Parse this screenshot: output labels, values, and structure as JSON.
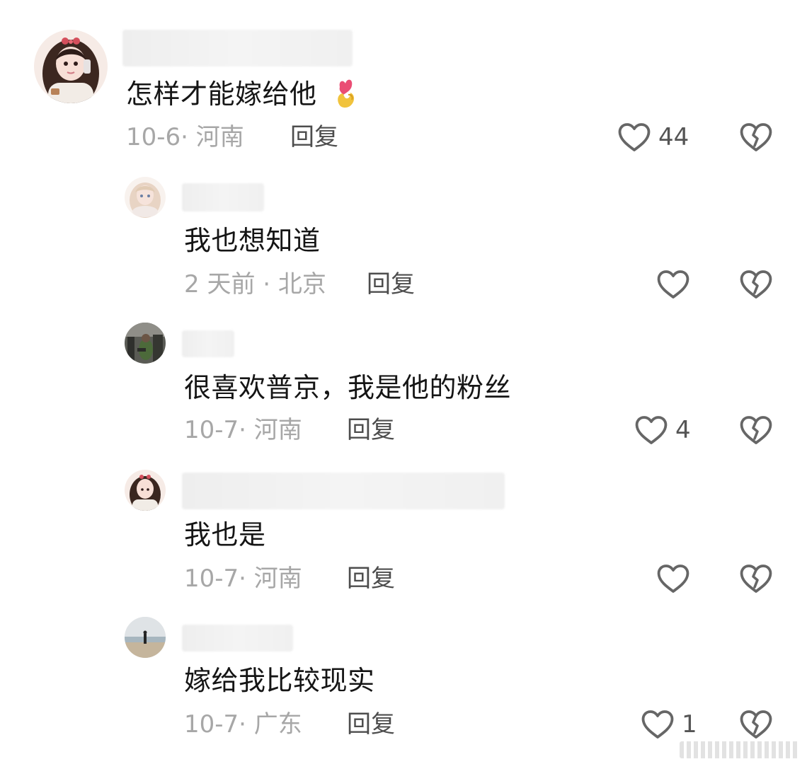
{
  "comments": [
    {
      "text": "怎样才能嫁给他",
      "emoji": "finger-heart-icon",
      "meta": "10-6· 河南",
      "reply_label": "回复",
      "likes": "44"
    },
    {
      "text": "我也想知道",
      "meta": "2 天前 · 北京",
      "reply_label": "回复",
      "likes": ""
    },
    {
      "text": "很喜欢普京，我是他的粉丝",
      "meta": "10-7· 河南",
      "reply_label": "回复",
      "likes": "4"
    },
    {
      "text": "我也是",
      "meta": "10-7· 河南",
      "reply_label": "回复",
      "likes": ""
    },
    {
      "text": "嫁给我比较现实",
      "meta": "10-7· 广东",
      "reply_label": "回复",
      "likes": "1"
    }
  ],
  "icons": {
    "like": "heart-outline-icon",
    "dislike": "broken-heart-icon"
  },
  "colors": {
    "text": "#151515",
    "meta": "#a7a7a7",
    "reply": "#4d4d4d",
    "icon_stroke": "#666666"
  }
}
